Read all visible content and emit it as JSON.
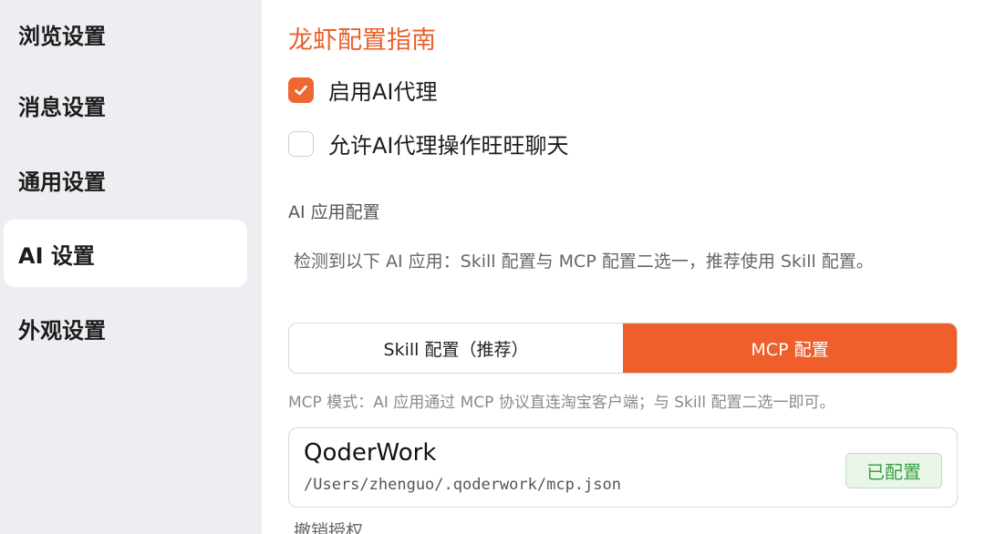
{
  "sidebar": {
    "items": [
      {
        "label": "浏览设置"
      },
      {
        "label": "消息设置"
      },
      {
        "label": "通用设置"
      },
      {
        "label": "AI 设置"
      },
      {
        "label": "外观设置"
      }
    ]
  },
  "main": {
    "guide_title": "龙虾配置指南",
    "checkboxes": [
      {
        "label": "启用AI代理",
        "checked": true
      },
      {
        "label": "允许AI代理操作旺旺聊天",
        "checked": false
      }
    ],
    "section_label": "AI 应用配置",
    "description": "检测到以下 AI 应用：Skill 配置与 MCP 配置二选一，推荐使用 Skill 配置。",
    "tabs": [
      {
        "label": "Skill 配置（推荐）",
        "active": false
      },
      {
        "label": "MCP 配置",
        "active": true
      }
    ],
    "mode_note": "MCP 模式：AI 应用通过 MCP 协议直连淘宝客户端；与 Skill 配置二选一即可。",
    "app_card": {
      "name": "QoderWork",
      "path": "/Users/zhenguo/.qoderwork/mcp.json",
      "status": "已配置"
    },
    "revoke_label": "撤销授权"
  },
  "colors": {
    "accent": "#ee5f2c",
    "status_green": "#3aa04a",
    "sidebar_bg": "#efedf2"
  },
  "icons": {
    "checkmark": "check-icon"
  }
}
